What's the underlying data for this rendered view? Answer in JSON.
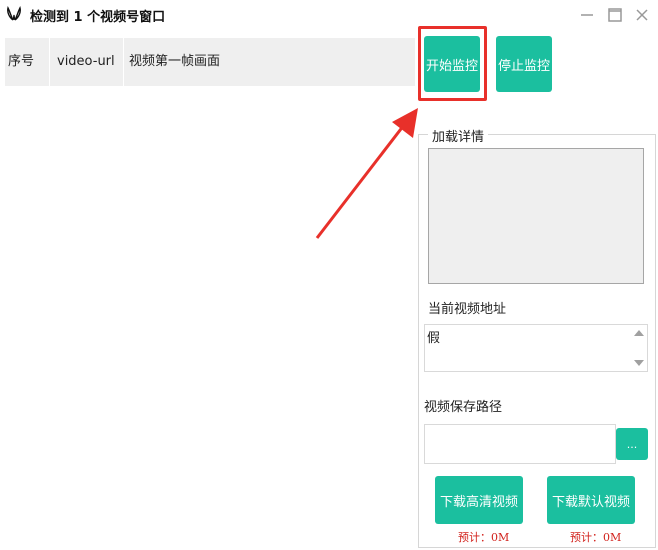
{
  "window": {
    "title": "检测到 1 个视频号窗口",
    "app_icon": "butterfly-logo-icon",
    "controls": {
      "minimize": "minimize-icon",
      "maximize": "maximize-icon",
      "close": "close-icon"
    }
  },
  "table": {
    "columns": [
      "序号",
      "video-url",
      "视频第一帧画面"
    ],
    "rows": []
  },
  "controls": {
    "start_label": "开始监控",
    "stop_label": "停止监控"
  },
  "details": {
    "group_title": "加载详情",
    "current_url_label": "当前视频地址",
    "current_url_value": "假",
    "save_path_label": "视频保存路径",
    "save_path_value": "",
    "browse_label": "...",
    "download_hd_label": "下载高清视频",
    "download_default_label": "下载默认视频",
    "estimate_hd": "预计：0M",
    "estimate_default": "预计：0M"
  },
  "colors": {
    "accent": "#1bbf9f",
    "highlight": "#e8302a",
    "estimate_text": "#d2221c"
  }
}
